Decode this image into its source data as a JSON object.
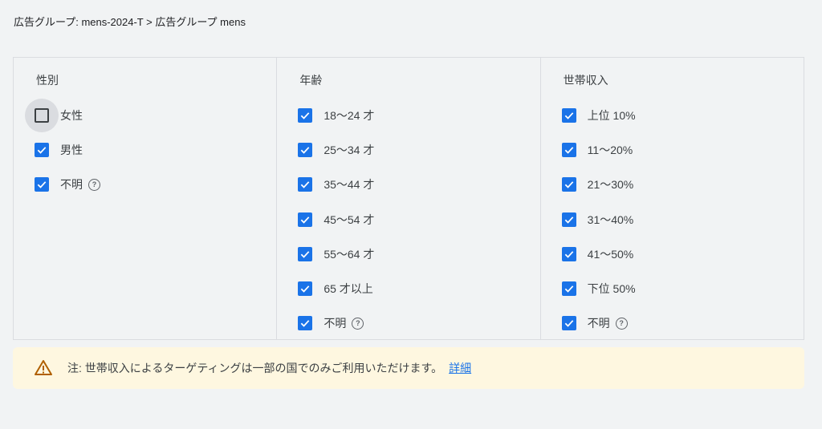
{
  "breadcrumb": "広告グループ: mens-2024-T > 広告グループ mens",
  "colors": {
    "accent": "#1a73e8",
    "note_bg": "#fef7e0",
    "warn": "#b06000"
  },
  "gender": {
    "title": "性別",
    "options": [
      {
        "label": "女性",
        "checked": false,
        "help": false
      },
      {
        "label": "男性",
        "checked": true,
        "help": false
      },
      {
        "label": "不明",
        "checked": true,
        "help": true
      }
    ]
  },
  "age": {
    "title": "年齢",
    "options": [
      {
        "label": "18～24 才",
        "checked": true,
        "help": false
      },
      {
        "label": "25～34 才",
        "checked": true,
        "help": false
      },
      {
        "label": "35～44 才",
        "checked": true,
        "help": false
      },
      {
        "label": "45～54 才",
        "checked": true,
        "help": false
      },
      {
        "label": "55～64 才",
        "checked": true,
        "help": false
      },
      {
        "label": "65 才以上",
        "checked": true,
        "help": false
      },
      {
        "label": "不明",
        "checked": true,
        "help": true
      }
    ]
  },
  "income": {
    "title": "世帯収入",
    "options": [
      {
        "label": "上位 10%",
        "checked": true,
        "help": false
      },
      {
        "label": "11～20%",
        "checked": true,
        "help": false
      },
      {
        "label": "21～30%",
        "checked": true,
        "help": false
      },
      {
        "label": "31～40%",
        "checked": true,
        "help": false
      },
      {
        "label": "41～50%",
        "checked": true,
        "help": false
      },
      {
        "label": "下位 50%",
        "checked": true,
        "help": false
      },
      {
        "label": "不明",
        "checked": true,
        "help": true
      }
    ]
  },
  "note": {
    "text": "注: 世帯収入によるターゲティングは一部の国でのみご利用いただけます。",
    "link": "詳細",
    "icon": "warning-icon"
  },
  "help_glyph": "?"
}
